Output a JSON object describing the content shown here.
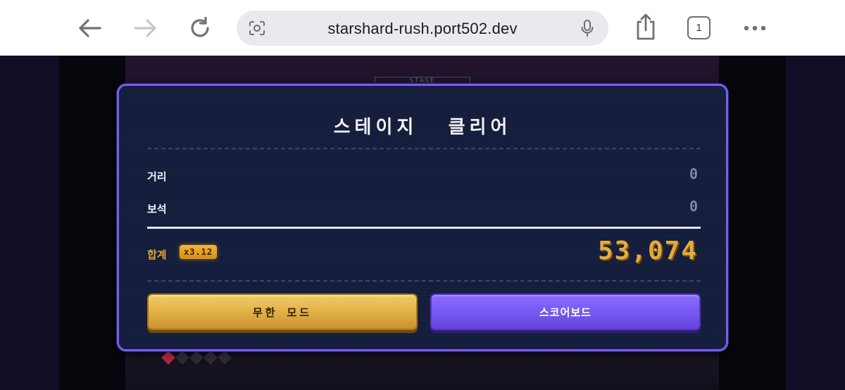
{
  "browser": {
    "url": "starshard-rush.port502.dev",
    "tab_count": "1",
    "icons": [
      "back-arrow-icon",
      "forward-arrow-icon",
      "reload-icon",
      "camera-search-icon",
      "microphone-icon",
      "share-icon",
      "tabs-icon",
      "more-icon"
    ]
  },
  "game": {
    "stage_tag": "STAGE",
    "lives": {
      "filled": 1,
      "total": 5
    }
  },
  "modal": {
    "title": "스테이지  클리어",
    "rows": [
      {
        "label": "거리",
        "value": "0"
      },
      {
        "label": "보석",
        "value": "0"
      }
    ],
    "total_label": "합계",
    "multiplier": "x3.12",
    "total_value": "53,074",
    "buttons": {
      "endless": "무한 모드",
      "scoreboard": "스코어보드"
    }
  },
  "colors": {
    "modal_border": "#7a5cf0",
    "modal_bg": "#141d3b",
    "gold": "#e3ac3f",
    "purple_button": "#7457f0"
  }
}
